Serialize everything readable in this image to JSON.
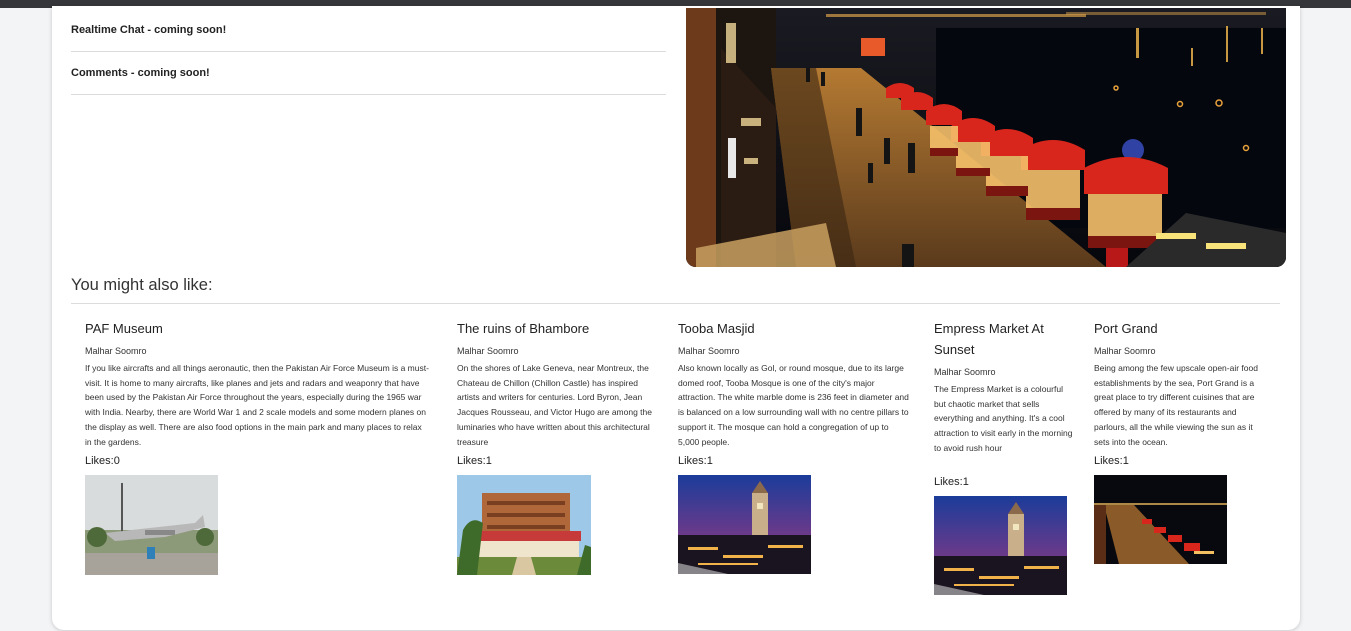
{
  "features": [
    {
      "label": "Realtime Chat - coming soon!"
    },
    {
      "label": "Comments - coming soon!"
    }
  ],
  "recommendations": {
    "heading": "You might also like:",
    "items": [
      {
        "title": "PAF Museum",
        "author": "Malhar Soomro",
        "description": "If you like aircrafts and all things aeronautic, then the Pakistan Air Force Museum is a must-visit. It is home to many aircrafts, like planes and jets and radars and weaponry that have been used by the Pakistan Air Force throughout the years, especially during the 1965 war with India. Nearby, there are World War 1 and 2 scale models and some modern planes on the display as well. There are also food options in the main park and many places to relax in the gardens.",
        "likes": "Likes:0",
        "image": "photo of a jet aircraft on display at a park"
      },
      {
        "title": "The ruins of Bhambore",
        "author": "Malhar Soomro",
        "description": "On the shores of Lake Geneva, near Montreux, the Chateau de Chillon (Chillon Castle) has inspired artists and writers for centuries. Lord Byron, Jean Jacques Rousseau, and Victor Hugo are among the luminaries who have written about this architectural treasure",
        "likes": "Likes:1",
        "image": "photo of a large brick building with palm trees"
      },
      {
        "title": "Tooba Masjid",
        "author": "Malhar Soomro",
        "description": "Also known locally as Gol, or round mosque, due to its large domed roof, Tooba Mosque is one of the city's major attraction. The white marble dome is 236 feet in diameter and is balanced on a low surrounding wall with no centre pillars to support it. The mosque can hold a congregation of up to 5,000 people.",
        "likes": "Likes:1",
        "image": "photo of a clock tower over a busy market at dusk"
      },
      {
        "title": "Empress Market At Sunset",
        "author": "Malhar Soomro",
        "description": "The Empress Market is a colourful but chaotic market that sells everything and anything. It's a cool attraction to visit early in the morning to avoid rush hour",
        "likes": "Likes:1",
        "image": "photo of a clock tower over a busy market at dusk"
      },
      {
        "title": "Port Grand",
        "author": "Malhar Soomro",
        "description": "Being among the few upscale open-air food establishments by the sea, Port Grand is a great place to try different cuisines that are offered by many of its restaurants and parlours, all the while viewing the sun as it sets into the ocean.",
        "likes": "Likes:1",
        "image": "night photo of a waterfront promenade with food stalls"
      }
    ]
  },
  "colors": {
    "card": "#ffffff",
    "background": "#f3f4f6",
    "stall_red": "#d8261c"
  }
}
